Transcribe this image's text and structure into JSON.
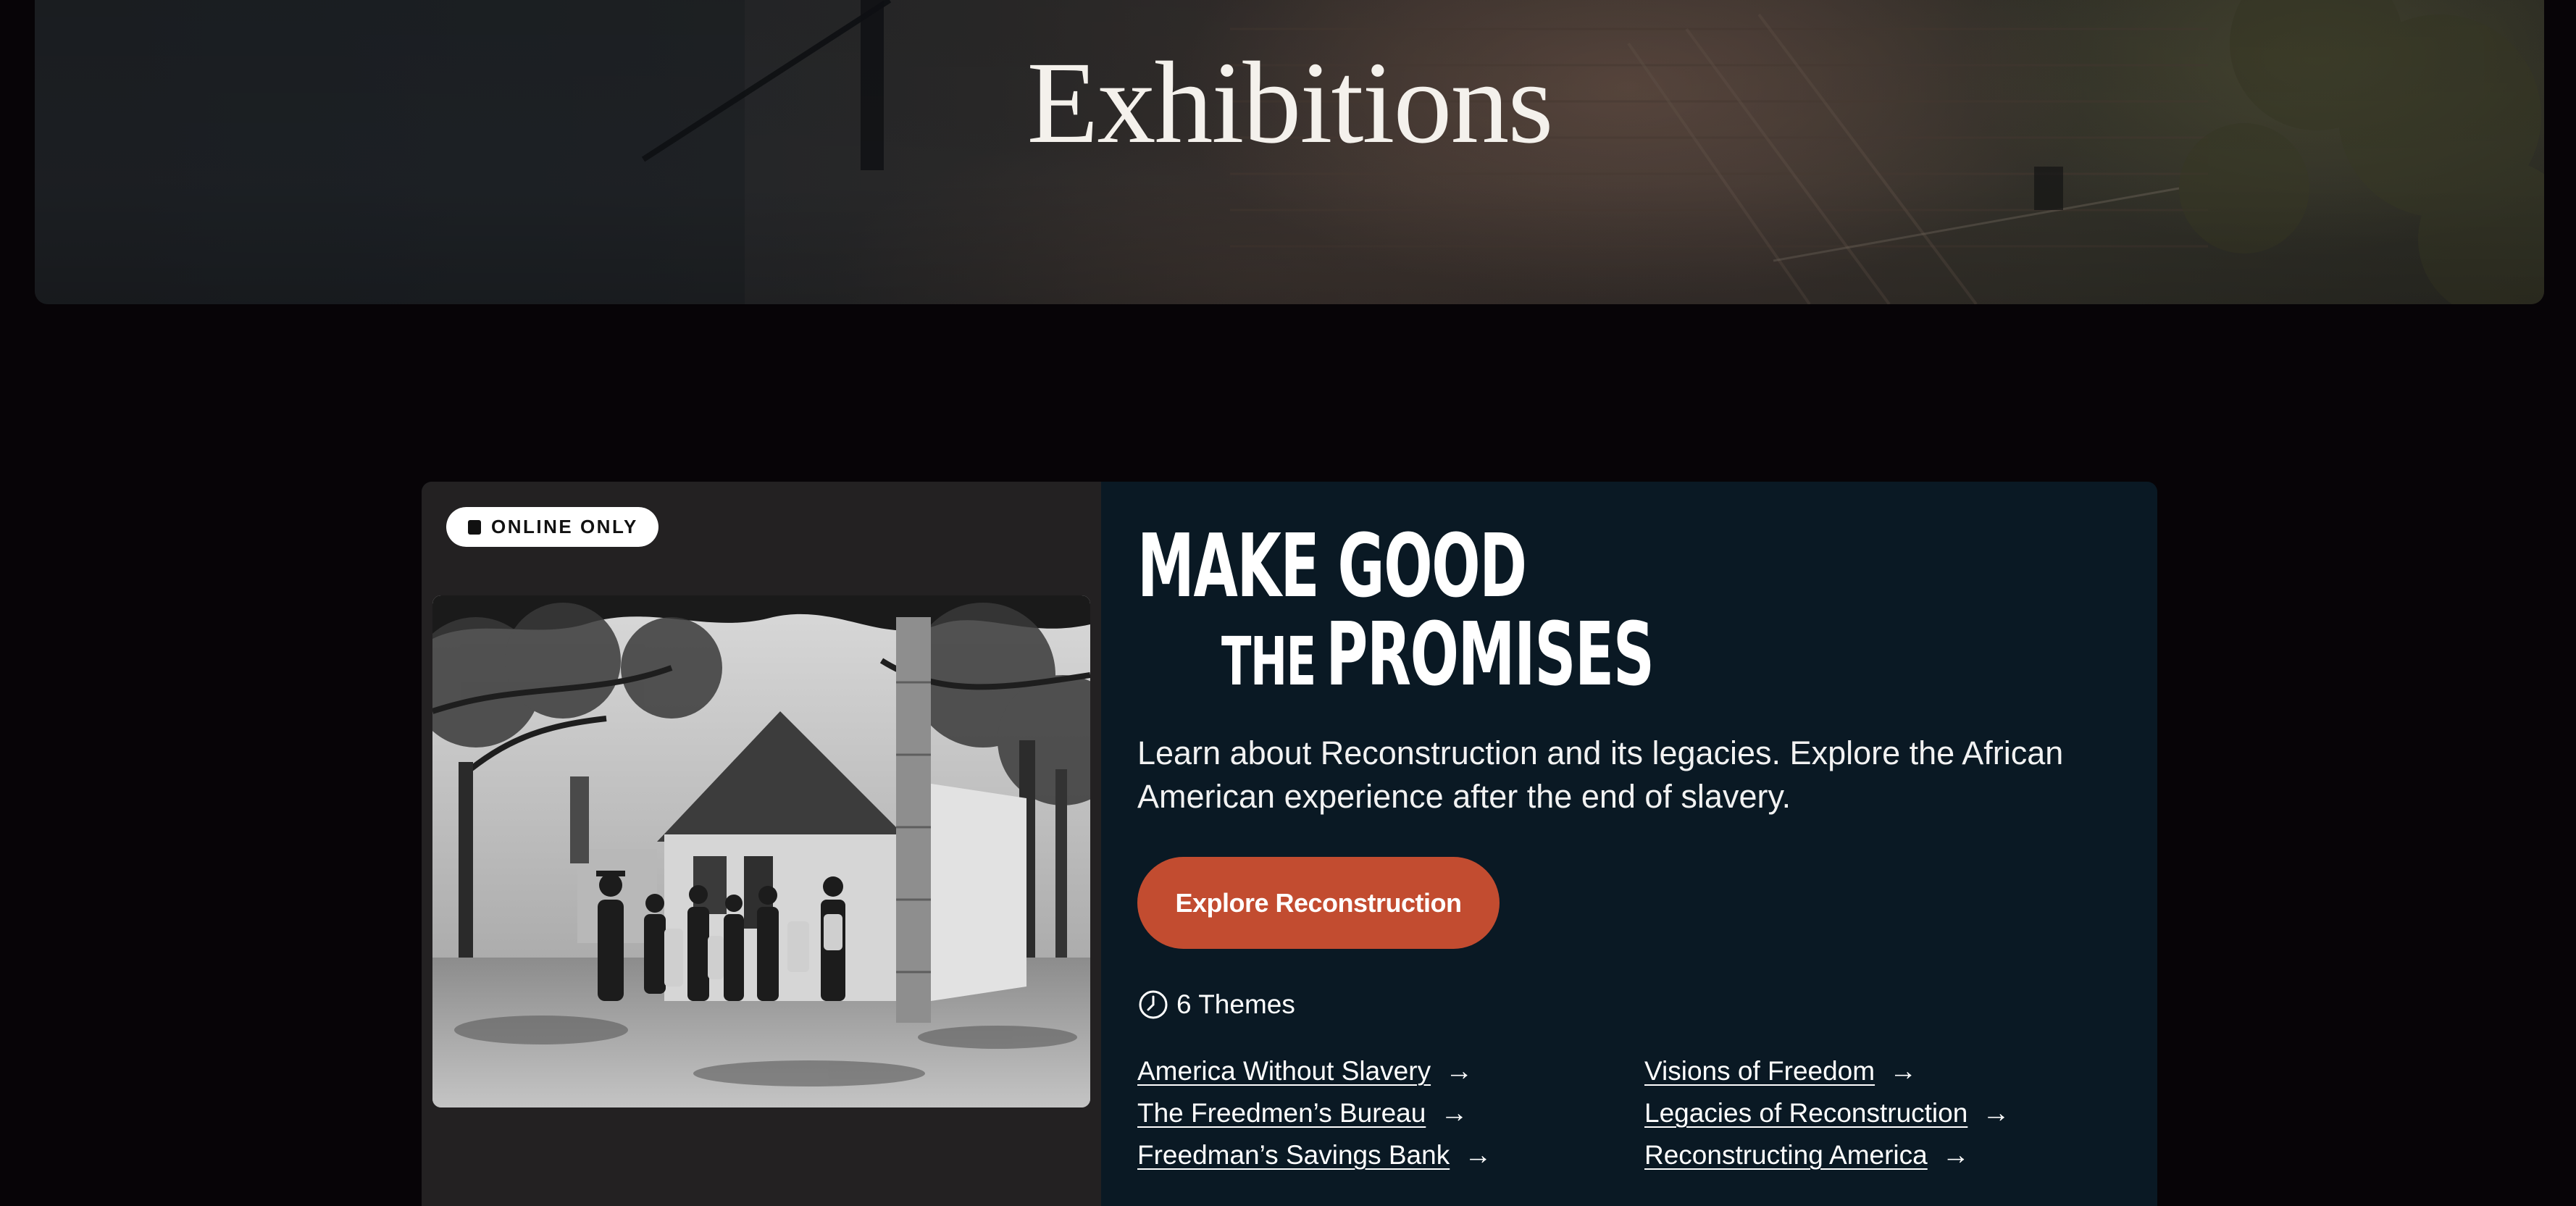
{
  "hero": {
    "title": "Exhibitions"
  },
  "exhibition": {
    "badge": {
      "label": "ONLINE ONLY",
      "icon": "square-icon"
    },
    "title": {
      "line1": "MAKE GOOD",
      "line2_small": "THE",
      "line2_large": "PROMISES"
    },
    "description": "Learn about Reconstruction and its legacies. Explore the African American experience after the end of slavery.",
    "cta_label": "Explore Reconstruction",
    "themes_count": "6 Themes",
    "themes_icon": "clock-icon",
    "themes": [
      {
        "label": "America Without Slavery"
      },
      {
        "label": "The Freedmen’s Bureau"
      },
      {
        "label": "Freedman’s Savings Bank"
      },
      {
        "label": "Visions of Freedom"
      },
      {
        "label": "Legacies of Reconstruction"
      },
      {
        "label": "Reconstructing America"
      }
    ],
    "arrow_glyph": "→"
  },
  "colors": {
    "page_background": "#070407",
    "card_background": "#0a1924",
    "card_left_background": "#232122",
    "cta_background": "#c24c30",
    "text": "#ffffff"
  }
}
